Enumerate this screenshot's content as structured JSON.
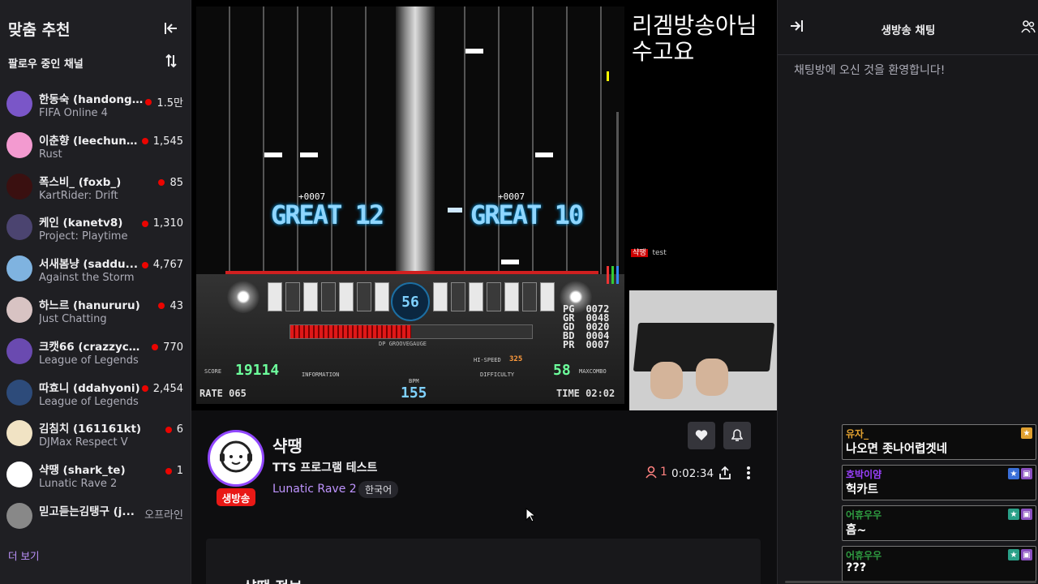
{
  "sidebar": {
    "title": "맞춤 추천",
    "subtitle": "팔로우 중인 채널",
    "more": "더 보기",
    "channels": [
      {
        "name": "한동숙 (handongs...",
        "game": "FIFA Online 4",
        "viewers": "1.5만",
        "live": true,
        "color": "#7a56c8"
      },
      {
        "name": "이춘향 (leechunh...",
        "game": "Rust",
        "viewers": "1,545",
        "live": true,
        "color": "#f39ad0"
      },
      {
        "name": "폭스비_ (foxb_)",
        "game": "KartRider: Drift",
        "viewers": "85",
        "live": true,
        "color": "#3a1010"
      },
      {
        "name": "케인 (kanetv8)",
        "game": "Project: Playtime",
        "viewers": "1,310",
        "live": true,
        "color": "#4b4470"
      },
      {
        "name": "서새봄냥 (saddu...",
        "game": "Against the Storm",
        "viewers": "4,767",
        "live": true,
        "color": "#7fb3e0"
      },
      {
        "name": "하느르 (hanururu)",
        "game": "Just Chatting",
        "viewers": "43",
        "live": true,
        "color": "#d8c3c3"
      },
      {
        "name": "크캣66 (crazzycc...",
        "game": "League of Legends",
        "viewers": "770",
        "live": true,
        "color": "#6a4ab0"
      },
      {
        "name": "따효니 (ddahyoni)",
        "game": "League of Legends",
        "viewers": "2,454",
        "live": true,
        "color": "#2d4b7a"
      },
      {
        "name": "김침치 (161161kt)",
        "game": "DJMax Respect V",
        "viewers": "6",
        "live": true,
        "color": "#f1e3c4"
      },
      {
        "name": "샥땡 (shark_te)",
        "game": "Lunatic Rave 2",
        "viewers": "1",
        "live": true,
        "color": "#ffffff"
      },
      {
        "name": "믿고듣는김탱구 (j...",
        "game": "",
        "viewers": "오프라인",
        "live": false,
        "color": "#888888"
      }
    ]
  },
  "video": {
    "overlay_text": "리겜방송아님\n수고요",
    "judge_left": "GREAT 12",
    "judge_right": "GREAT 10",
    "combo_left": "+0007",
    "combo_right": "+0007",
    "center_speed": "56",
    "gauge_label": "DP GROOVEGAUGE",
    "gauge_fill": 0.5,
    "score_label": "SCORE",
    "score": "19114",
    "information_label": "INFORMATION",
    "bpm_label": "BPM",
    "bpm": "155",
    "hispeed_label": "HI-SPEED",
    "hispeed": "325",
    "difficulty_label": "DIFFICULTY",
    "maxcombo": "58",
    "maxcombo_label": "MAXCOMBO",
    "rate": "RATE 065",
    "time": "TIME 02:02",
    "judge_counts": [
      {
        "k": "PG",
        "v": "0072"
      },
      {
        "k": "GR",
        "v": "0048"
      },
      {
        "k": "GD",
        "v": "0020"
      },
      {
        "k": "BD",
        "v": "0004"
      },
      {
        "k": "PR",
        "v": "0007"
      }
    ],
    "chat_overlay_user": "샥땡",
    "chat_overlay_msg": "test"
  },
  "stream": {
    "streamer": "샥땡",
    "live_badge": "생방송",
    "title": "TTS 프로그램 테스트",
    "game": "Lunatic Rave 2",
    "tag": "한국어",
    "viewers": "1",
    "uptime": "0:02:34",
    "about_title": "샥땡 정보"
  },
  "chat": {
    "title": "생방송 채팅",
    "welcome": "채팅방에 오신 것을 환영합니다!",
    "overlay_messages": [
      {
        "user": "유자_",
        "user_color": "#e0a030",
        "text": "나오면 좃나어렵겟네"
      },
      {
        "user": "호박이얌",
        "user_color": "#9b40ff",
        "text": "헉카트"
      },
      {
        "user": "어휴우우",
        "user_color": "#2e9a40",
        "text": "흠~"
      },
      {
        "user": "어휴우우",
        "user_color": "#2e9a40",
        "text": "???"
      }
    ]
  },
  "colors": {
    "accent": "#9147ff",
    "live": "#e91916",
    "link": "#bf94ff"
  }
}
